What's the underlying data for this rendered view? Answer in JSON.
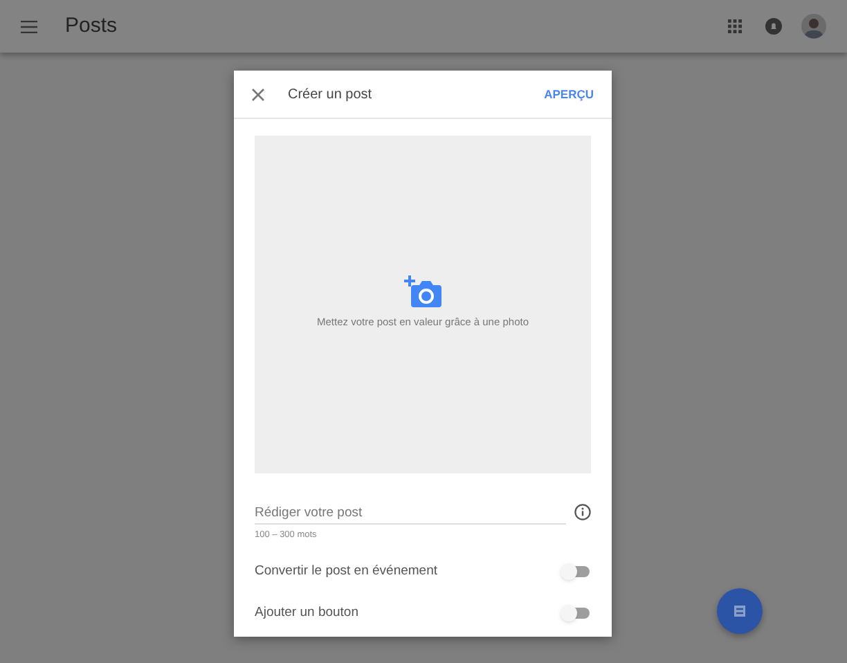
{
  "app_bar": {
    "title": "Posts"
  },
  "dialog": {
    "title": "Créer un post",
    "action": "APERÇU",
    "photo": {
      "hint": "Mettez votre post en valeur grâce à une photo"
    },
    "post_field": {
      "placeholder": "Rédiger votre post",
      "helper": "100 – 300 mots"
    },
    "toggles": [
      {
        "label": "Convertir le post en événement",
        "on": false
      },
      {
        "label": "Ajouter un bouton",
        "on": false
      }
    ]
  }
}
